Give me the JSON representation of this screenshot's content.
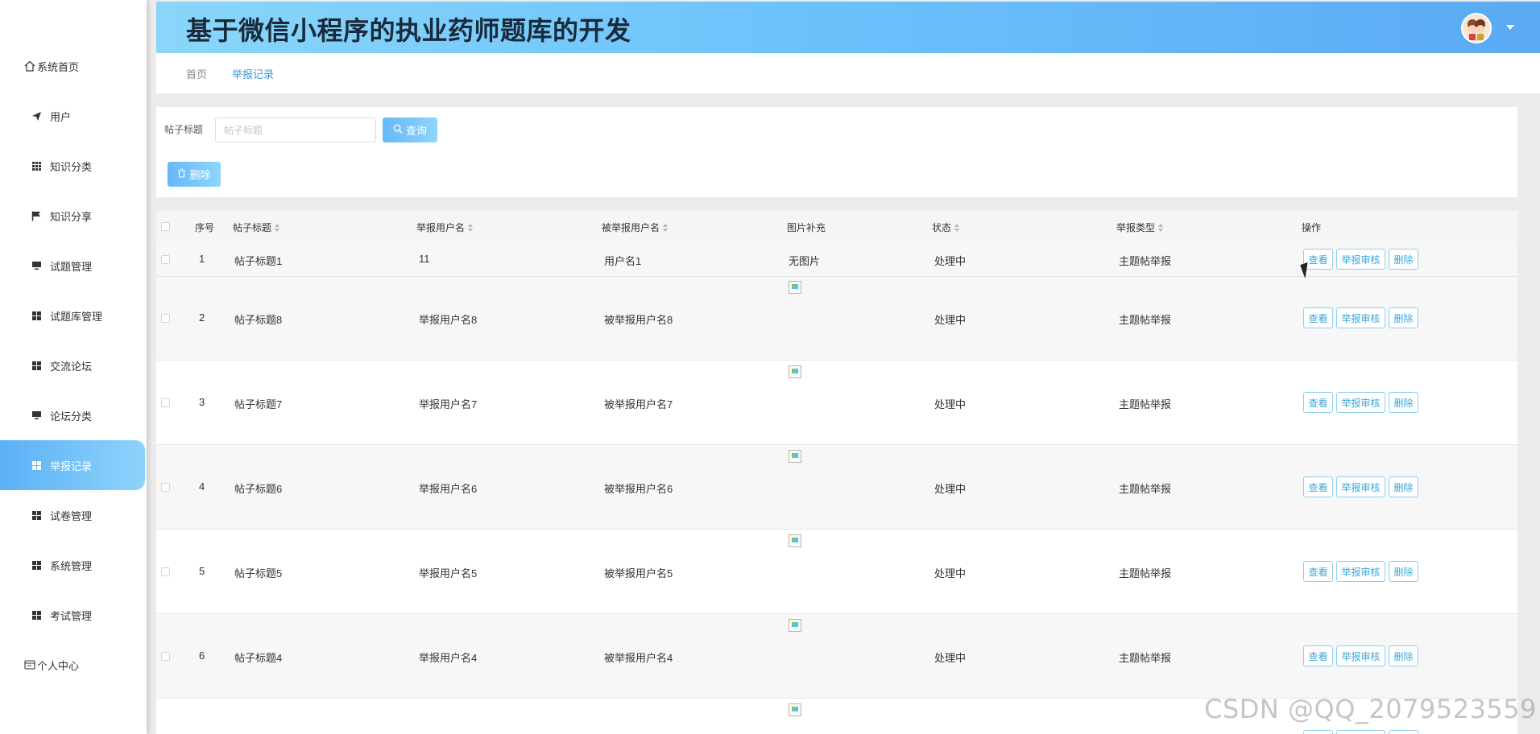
{
  "header": {
    "title": "基于微信小程序的执业药师题库的开发"
  },
  "sidebar": {
    "items": [
      {
        "label": "系统首页",
        "icon": "home-icon"
      },
      {
        "label": "用户",
        "icon": "send-icon"
      },
      {
        "label": "知识分类",
        "icon": "grid-icon"
      },
      {
        "label": "知识分享",
        "icon": "flag-icon"
      },
      {
        "label": "试题管理",
        "icon": "monitor-icon"
      },
      {
        "label": "试题库管理",
        "icon": "grid-icon"
      },
      {
        "label": "交流论坛",
        "icon": "grid-icon"
      },
      {
        "label": "论坛分类",
        "icon": "monitor-icon"
      },
      {
        "label": "举报记录",
        "icon": "grid-icon"
      },
      {
        "label": "试卷管理",
        "icon": "grid-icon"
      },
      {
        "label": "系统管理",
        "icon": "grid-icon"
      },
      {
        "label": "考试管理",
        "icon": "grid-icon"
      },
      {
        "label": "个人中心",
        "icon": "card-icon"
      }
    ],
    "active_index": 8
  },
  "breadcrumb": {
    "home": "首页",
    "current": "举报记录"
  },
  "search": {
    "label": "帖子标题",
    "placeholder": "帖子标题",
    "query_button": "查询",
    "delete_button": "删除"
  },
  "table": {
    "columns": [
      "序号",
      "帖子标题",
      "举报用户名",
      "被举报用户名",
      "图片补充",
      "状态",
      "举报类型",
      "操作"
    ],
    "actions": [
      "查看",
      "举报审核",
      "删除"
    ],
    "rows": [
      {
        "index": "1",
        "title": "帖子标题1",
        "reporter": "11",
        "reported": "用户名1",
        "image": "无图片",
        "status": "处理中",
        "type": "主题帖举报"
      },
      {
        "index": "2",
        "title": "帖子标题8",
        "reporter": "举报用户名8",
        "reported": "被举报用户名8",
        "image": "",
        "status": "处理中",
        "type": "主题帖举报"
      },
      {
        "index": "3",
        "title": "帖子标题7",
        "reporter": "举报用户名7",
        "reported": "被举报用户名7",
        "image": "",
        "status": "处理中",
        "type": "主题帖举报"
      },
      {
        "index": "4",
        "title": "帖子标题6",
        "reporter": "举报用户名6",
        "reported": "被举报用户名6",
        "image": "",
        "status": "处理中",
        "type": "主题帖举报"
      },
      {
        "index": "5",
        "title": "帖子标题5",
        "reporter": "举报用户名5",
        "reported": "被举报用户名5",
        "image": "",
        "status": "处理中",
        "type": "主题帖举报"
      },
      {
        "index": "6",
        "title": "帖子标题4",
        "reporter": "举报用户名4",
        "reported": "被举报用户名4",
        "image": "",
        "status": "处理中",
        "type": "主题帖举报"
      }
    ]
  },
  "watermark": "CSDN @QQ_2079523559",
  "colors": {
    "accent": "#5ab0f5",
    "link": "#3a9ad9"
  }
}
